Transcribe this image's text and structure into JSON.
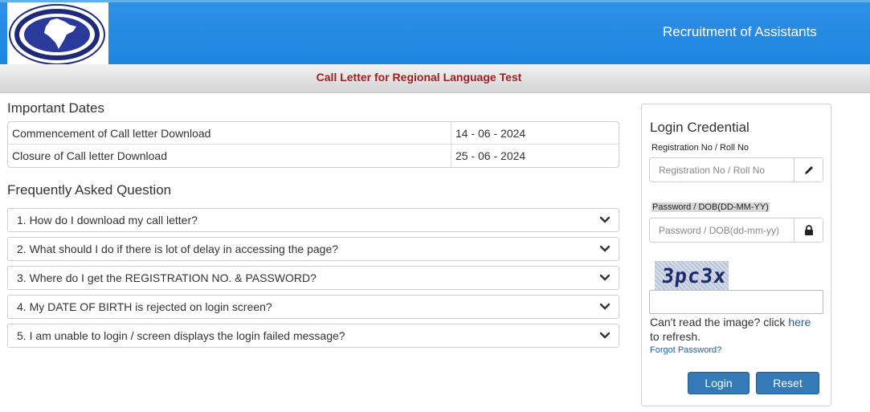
{
  "header": {
    "title": "Recruitment of Assistants",
    "logo_text": "THE NEW INDIA ASSURANCE CO. LTD."
  },
  "subheader": {
    "title": "Call Letter for Regional Language Test"
  },
  "important_dates": {
    "title": "Important Dates",
    "rows": [
      {
        "label": "Commencement of Call letter Download",
        "value": "14 - 06 - 2024"
      },
      {
        "label": "Closure of Call letter Download",
        "value": "25 - 06 - 2024"
      }
    ]
  },
  "faq": {
    "title": "Frequently Asked Question",
    "items": [
      {
        "label": "1. How do I download my call letter?"
      },
      {
        "label": "2. What should I do if there is lot of delay in accessing the page?"
      },
      {
        "label": "3. Where do I get the REGISTRATION NO. & PASSWORD?"
      },
      {
        "label": "4. My DATE OF BIRTH is rejected on login screen?"
      },
      {
        "label": "5. I am unable to login / screen displays the login failed message?"
      }
    ]
  },
  "login": {
    "title": "Login Credential",
    "registration_label": "Registration No / Roll No",
    "registration_placeholder": "Registration No / Roll No",
    "password_label": "Password / DOB(DD-MM-YY)",
    "password_placeholder": "Password / DOB(dd-mm-yy)",
    "captcha_text": "3pc3x",
    "captcha_help_prefix": "Can't read the image? click ",
    "captcha_help_link": "here",
    "captcha_help_suffix": " to refresh.",
    "forgot_password": "Forgot Password?",
    "login_button": "Login",
    "reset_button": "Reset"
  },
  "icons": {
    "registration_addon": "pencil-icon",
    "password_addon": "lock-icon",
    "faq_toggle": "chevron-down-icon"
  },
  "colors": {
    "header_blue": "#1e86e0",
    "subheader_title": "#9c1f1f",
    "button_blue": "#337ab7",
    "link_blue": "#1f5fa8"
  }
}
